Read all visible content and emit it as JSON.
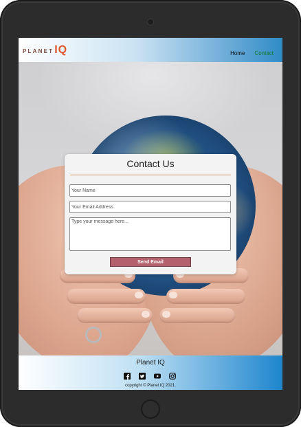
{
  "header": {
    "logo_planet": "PLANET",
    "logo_iq": "IQ",
    "nav": {
      "home": "Home",
      "contact": "Contact"
    }
  },
  "contact": {
    "title": "Contact Us",
    "name_placeholder": "Your Name",
    "email_placeholder": "Your Email Address",
    "message_placeholder": "Type your message here...",
    "send_label": "Send Email"
  },
  "footer": {
    "brand": "Planet IQ",
    "social_icons": [
      "facebook-icon",
      "twitter-icon",
      "youtube-icon",
      "instagram-icon"
    ],
    "copyright": "copyright © Planet IQ 2021."
  },
  "colors": {
    "accent": "#e3552d",
    "button": "#b3616d",
    "nav_active": "#117a2c"
  }
}
